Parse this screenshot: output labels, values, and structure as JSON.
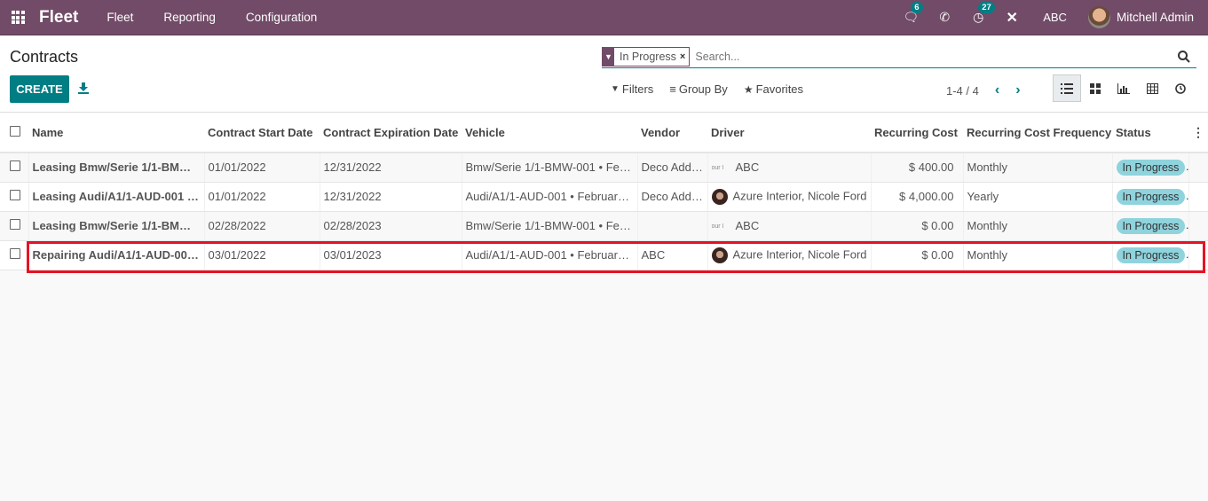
{
  "navbar": {
    "app_name": "Fleet",
    "menu": [
      "Fleet",
      "Reporting",
      "Configuration"
    ],
    "messages_badge": "6",
    "activities_badge": "27",
    "company": "ABC",
    "user": "Mitchell Admin"
  },
  "control_panel": {
    "title": "Contracts",
    "create_label": "CREATE",
    "facet": "In Progress",
    "search_placeholder": "Search...",
    "filters_label": "Filters",
    "groupby_label": "Group By",
    "favorites_label": "Favorites",
    "pager": "1-4 / 4"
  },
  "table": {
    "columns": [
      "Name",
      "Contract Start Date",
      "Contract Expiration Date",
      "Vehicle",
      "Vendor",
      "Driver",
      "Recurring Cost",
      "Recurring Cost Frequency",
      "Status"
    ],
    "rows": [
      {
        "name": "Leasing Bmw/Serie 1/1-BMW-...",
        "start": "01/01/2022",
        "end": "12/31/2022",
        "vehicle": "Bmw/Serie 1/1-BMW-001 • Feb...",
        "vendor": "Deco Addi...",
        "driver": "ABC",
        "driver_avatar": "logo",
        "cost": "$ 400.00",
        "freq": "Monthly",
        "status": "In Progress"
      },
      {
        "name": "Leasing Audi/A1/1-AUD-001 • ...",
        "start": "01/01/2022",
        "end": "12/31/2022",
        "vehicle": "Audi/A1/1-AUD-001 • February ...",
        "vendor": "Deco Addi...",
        "driver": "Azure Interior, Nicole Ford",
        "driver_avatar": "photo",
        "cost": "$ 4,000.00",
        "freq": "Yearly",
        "status": "In Progress"
      },
      {
        "name": "Leasing Bmw/Serie 1/1-BMW-...",
        "start": "02/28/2022",
        "end": "02/28/2023",
        "vehicle": "Bmw/Serie 1/1-BMW-001 • Feb...",
        "vendor": "",
        "driver": "ABC",
        "driver_avatar": "logo",
        "cost": "$ 0.00",
        "freq": "Monthly",
        "status": "In Progress"
      },
      {
        "name": "Repairing Audi/A1/1-AUD-001 ...",
        "start": "03/01/2022",
        "end": "03/01/2023",
        "vehicle": "Audi/A1/1-AUD-001 • February ...",
        "vendor": "ABC",
        "driver": "Azure Interior, Nicole Ford",
        "driver_avatar": "photo",
        "cost": "$ 0.00",
        "freq": "Monthly",
        "status": "In Progress"
      }
    ]
  },
  "colors": {
    "brand": "#714b67",
    "accent": "#017e84",
    "highlight": "#e81123",
    "status_pill": "#8fd3dd"
  }
}
